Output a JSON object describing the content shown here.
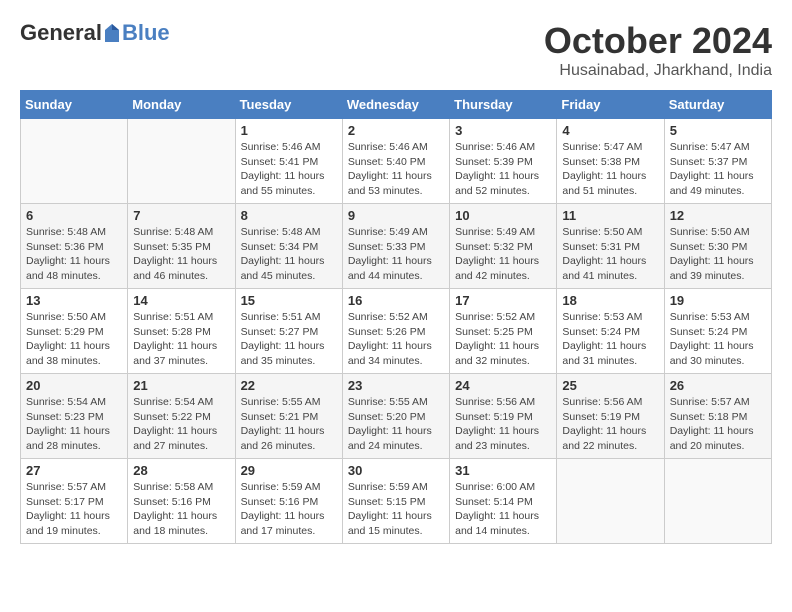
{
  "logo": {
    "general": "General",
    "blue": "Blue"
  },
  "title": "October 2024",
  "subtitle": "Husainabad, Jharkhand, India",
  "headers": [
    "Sunday",
    "Monday",
    "Tuesday",
    "Wednesday",
    "Thursday",
    "Friday",
    "Saturday"
  ],
  "weeks": [
    [
      {
        "day": "",
        "info": ""
      },
      {
        "day": "",
        "info": ""
      },
      {
        "day": "1",
        "info": "Sunrise: 5:46 AM\nSunset: 5:41 PM\nDaylight: 11 hours and 55 minutes."
      },
      {
        "day": "2",
        "info": "Sunrise: 5:46 AM\nSunset: 5:40 PM\nDaylight: 11 hours and 53 minutes."
      },
      {
        "day": "3",
        "info": "Sunrise: 5:46 AM\nSunset: 5:39 PM\nDaylight: 11 hours and 52 minutes."
      },
      {
        "day": "4",
        "info": "Sunrise: 5:47 AM\nSunset: 5:38 PM\nDaylight: 11 hours and 51 minutes."
      },
      {
        "day": "5",
        "info": "Sunrise: 5:47 AM\nSunset: 5:37 PM\nDaylight: 11 hours and 49 minutes."
      }
    ],
    [
      {
        "day": "6",
        "info": "Sunrise: 5:48 AM\nSunset: 5:36 PM\nDaylight: 11 hours and 48 minutes."
      },
      {
        "day": "7",
        "info": "Sunrise: 5:48 AM\nSunset: 5:35 PM\nDaylight: 11 hours and 46 minutes."
      },
      {
        "day": "8",
        "info": "Sunrise: 5:48 AM\nSunset: 5:34 PM\nDaylight: 11 hours and 45 minutes."
      },
      {
        "day": "9",
        "info": "Sunrise: 5:49 AM\nSunset: 5:33 PM\nDaylight: 11 hours and 44 minutes."
      },
      {
        "day": "10",
        "info": "Sunrise: 5:49 AM\nSunset: 5:32 PM\nDaylight: 11 hours and 42 minutes."
      },
      {
        "day": "11",
        "info": "Sunrise: 5:50 AM\nSunset: 5:31 PM\nDaylight: 11 hours and 41 minutes."
      },
      {
        "day": "12",
        "info": "Sunrise: 5:50 AM\nSunset: 5:30 PM\nDaylight: 11 hours and 39 minutes."
      }
    ],
    [
      {
        "day": "13",
        "info": "Sunrise: 5:50 AM\nSunset: 5:29 PM\nDaylight: 11 hours and 38 minutes."
      },
      {
        "day": "14",
        "info": "Sunrise: 5:51 AM\nSunset: 5:28 PM\nDaylight: 11 hours and 37 minutes."
      },
      {
        "day": "15",
        "info": "Sunrise: 5:51 AM\nSunset: 5:27 PM\nDaylight: 11 hours and 35 minutes."
      },
      {
        "day": "16",
        "info": "Sunrise: 5:52 AM\nSunset: 5:26 PM\nDaylight: 11 hours and 34 minutes."
      },
      {
        "day": "17",
        "info": "Sunrise: 5:52 AM\nSunset: 5:25 PM\nDaylight: 11 hours and 32 minutes."
      },
      {
        "day": "18",
        "info": "Sunrise: 5:53 AM\nSunset: 5:24 PM\nDaylight: 11 hours and 31 minutes."
      },
      {
        "day": "19",
        "info": "Sunrise: 5:53 AM\nSunset: 5:24 PM\nDaylight: 11 hours and 30 minutes."
      }
    ],
    [
      {
        "day": "20",
        "info": "Sunrise: 5:54 AM\nSunset: 5:23 PM\nDaylight: 11 hours and 28 minutes."
      },
      {
        "day": "21",
        "info": "Sunrise: 5:54 AM\nSunset: 5:22 PM\nDaylight: 11 hours and 27 minutes."
      },
      {
        "day": "22",
        "info": "Sunrise: 5:55 AM\nSunset: 5:21 PM\nDaylight: 11 hours and 26 minutes."
      },
      {
        "day": "23",
        "info": "Sunrise: 5:55 AM\nSunset: 5:20 PM\nDaylight: 11 hours and 24 minutes."
      },
      {
        "day": "24",
        "info": "Sunrise: 5:56 AM\nSunset: 5:19 PM\nDaylight: 11 hours and 23 minutes."
      },
      {
        "day": "25",
        "info": "Sunrise: 5:56 AM\nSunset: 5:19 PM\nDaylight: 11 hours and 22 minutes."
      },
      {
        "day": "26",
        "info": "Sunrise: 5:57 AM\nSunset: 5:18 PM\nDaylight: 11 hours and 20 minutes."
      }
    ],
    [
      {
        "day": "27",
        "info": "Sunrise: 5:57 AM\nSunset: 5:17 PM\nDaylight: 11 hours and 19 minutes."
      },
      {
        "day": "28",
        "info": "Sunrise: 5:58 AM\nSunset: 5:16 PM\nDaylight: 11 hours and 18 minutes."
      },
      {
        "day": "29",
        "info": "Sunrise: 5:59 AM\nSunset: 5:16 PM\nDaylight: 11 hours and 17 minutes."
      },
      {
        "day": "30",
        "info": "Sunrise: 5:59 AM\nSunset: 5:15 PM\nDaylight: 11 hours and 15 minutes."
      },
      {
        "day": "31",
        "info": "Sunrise: 6:00 AM\nSunset: 5:14 PM\nDaylight: 11 hours and 14 minutes."
      },
      {
        "day": "",
        "info": ""
      },
      {
        "day": "",
        "info": ""
      }
    ]
  ]
}
